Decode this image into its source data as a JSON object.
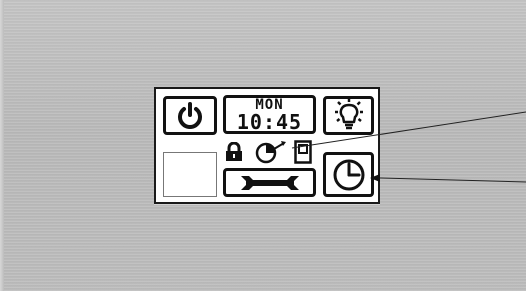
{
  "display": {
    "day": "MON",
    "time": "10:45"
  },
  "icons": {
    "power": "power-icon",
    "light": "lightbulb-icon",
    "lock": "lock-icon",
    "timer": "timer-icon",
    "window": "window-icon",
    "service": "wrench-icon",
    "clock": "clock-icon"
  },
  "colors": {
    "screen": "#ffffff",
    "ink": "#111111",
    "panel": "#bdbdbd"
  }
}
